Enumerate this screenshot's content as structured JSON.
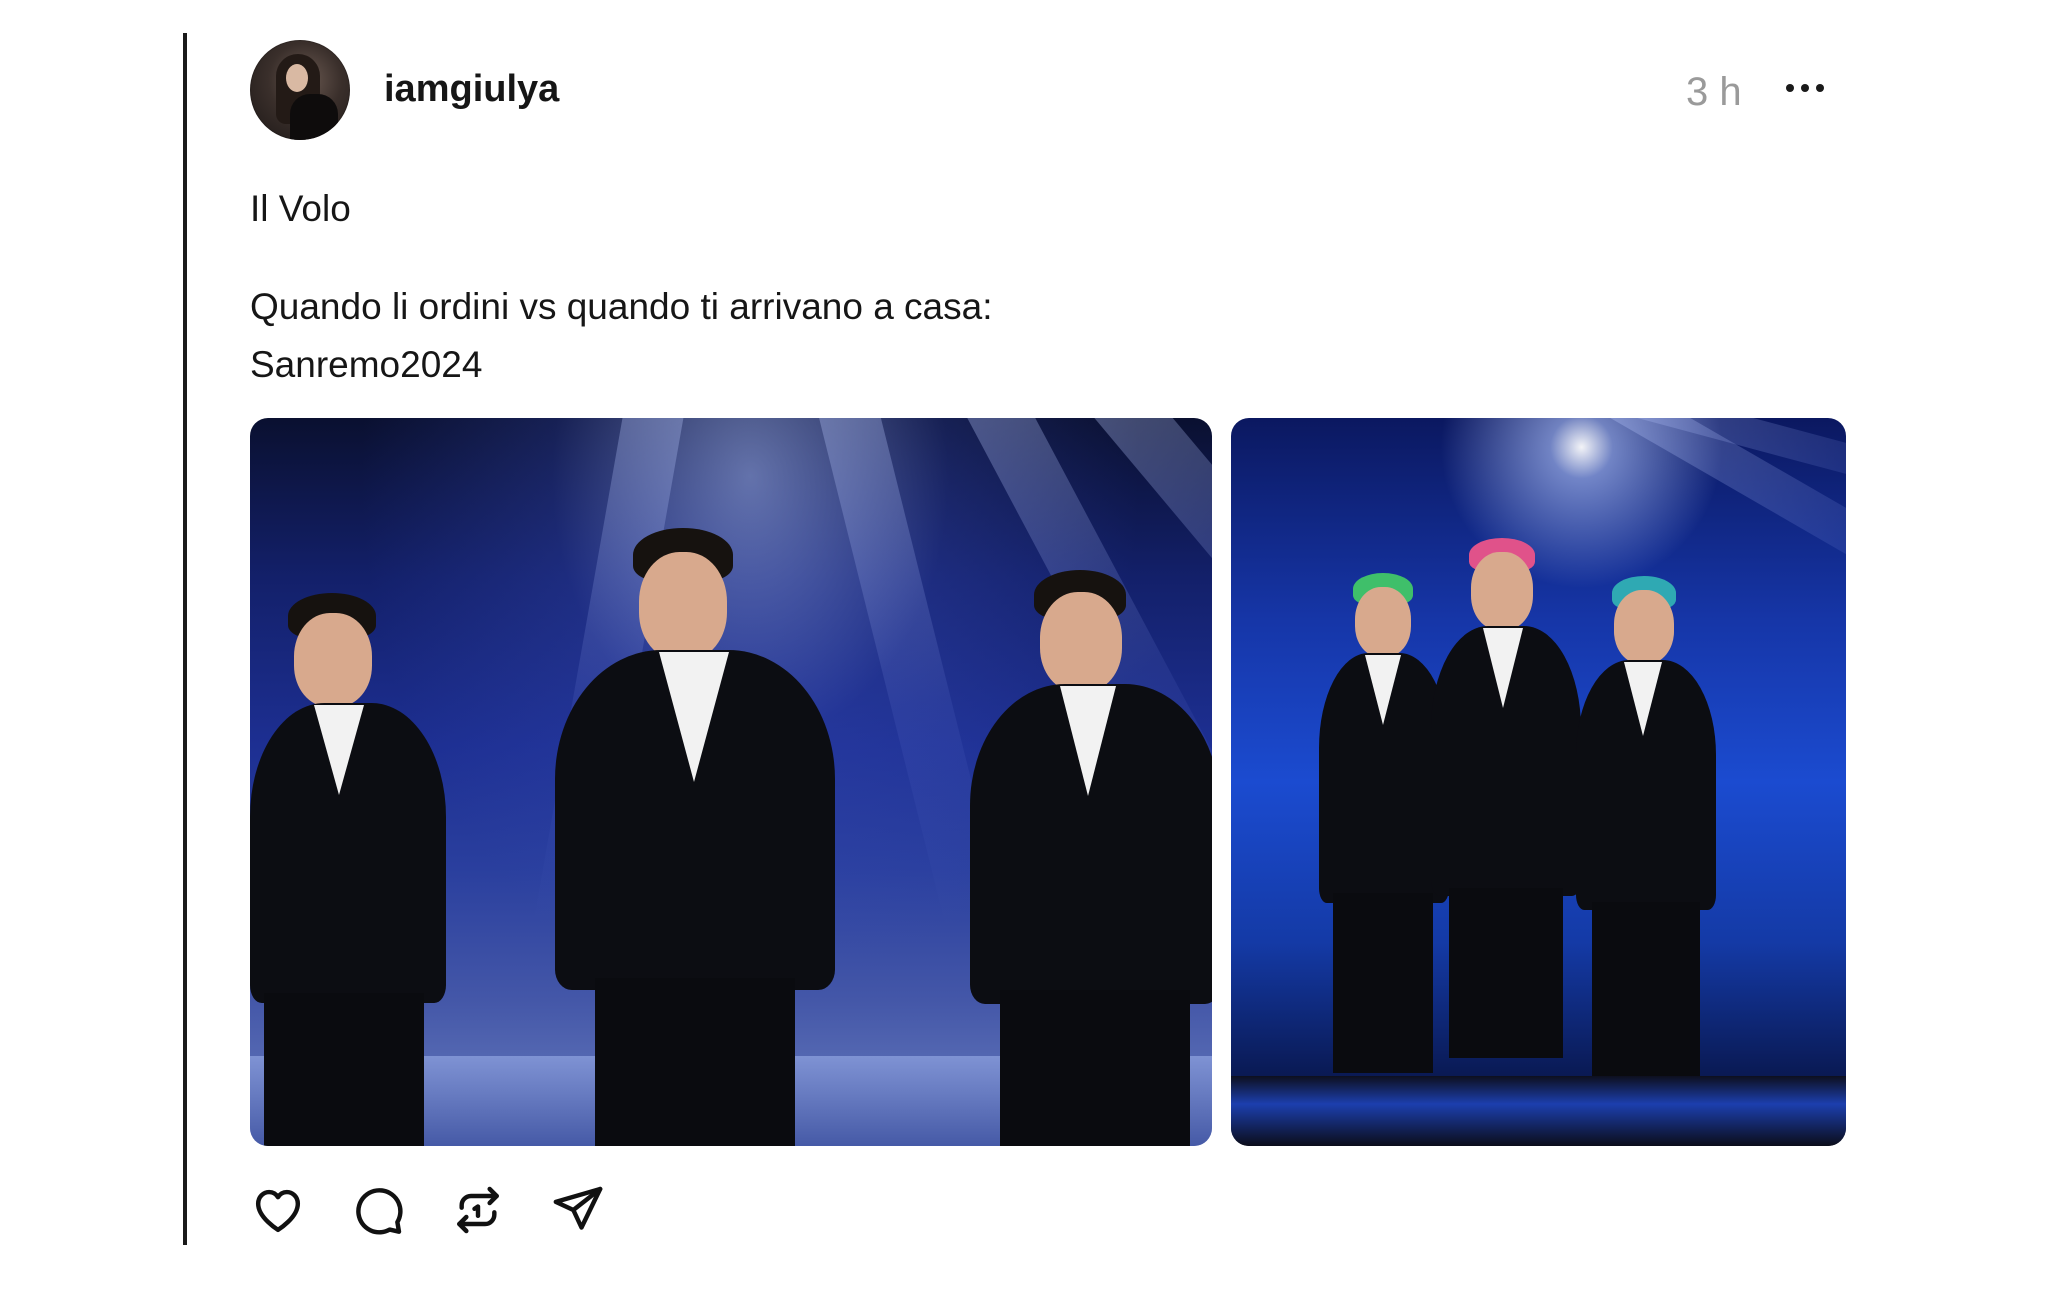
{
  "post": {
    "username": "iamgiulya",
    "timestamp": "3 h",
    "caption": {
      "line1": "Il Volo",
      "line2": "Quando li ordini vs quando ti arrivano a casa:",
      "line3": "Sanremo2024"
    }
  },
  "actions": {
    "icons": [
      "heart-icon",
      "comment-icon",
      "repost-icon",
      "share-icon"
    ]
  },
  "icons": {
    "more": "more-options-icon",
    "avatar": "user-avatar"
  }
}
